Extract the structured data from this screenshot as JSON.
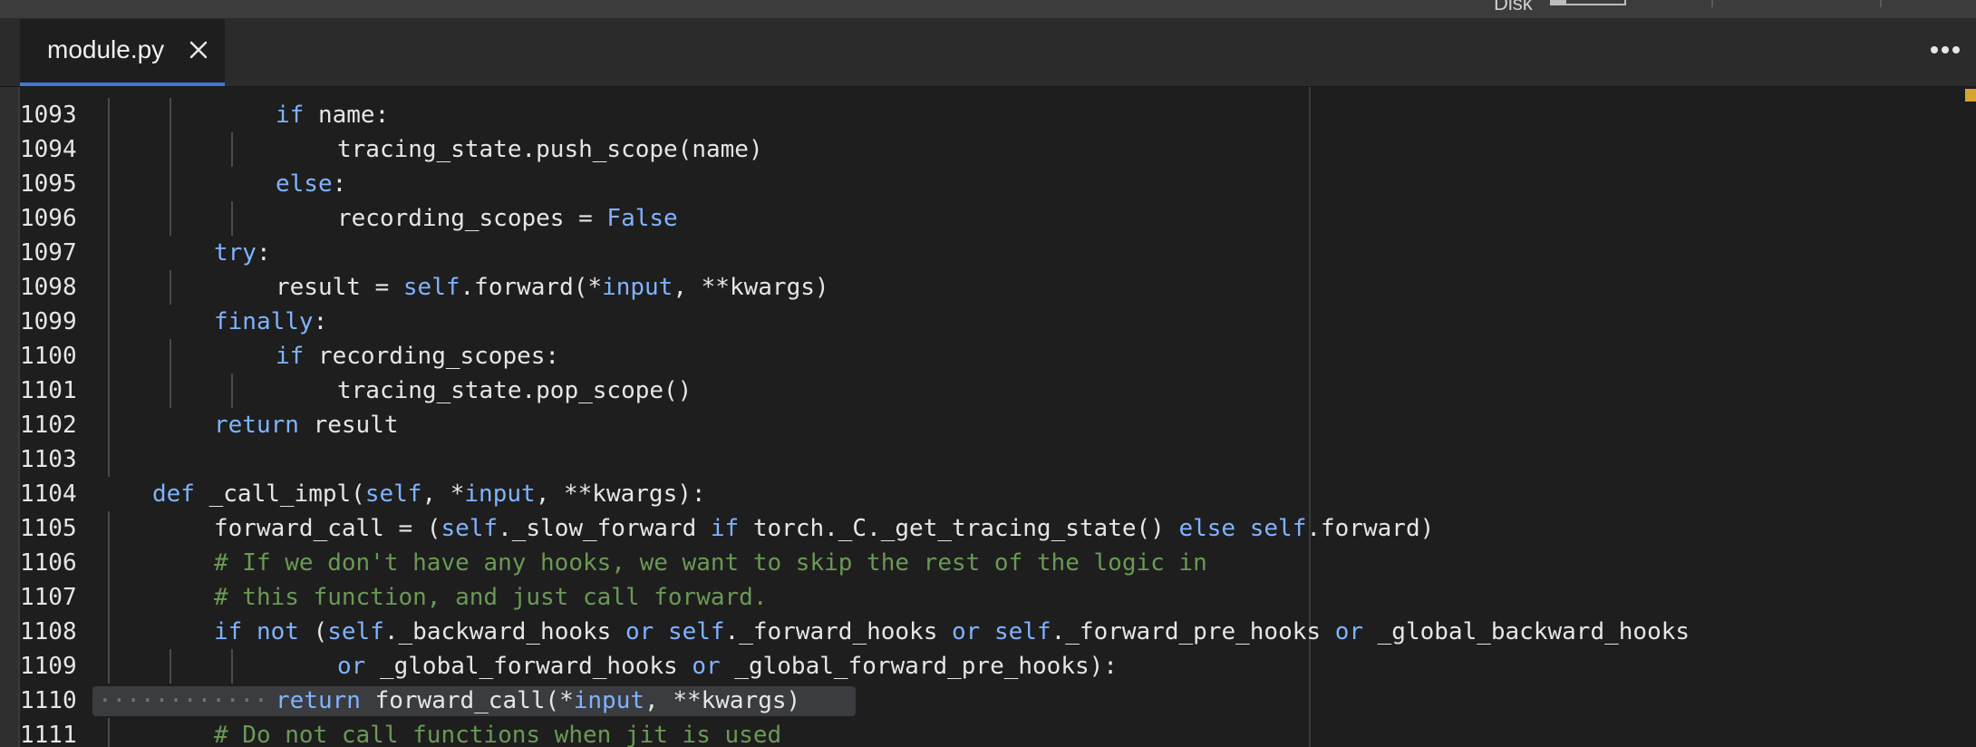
{
  "status_bar": {
    "disk_label": "Disk",
    "disk_usage_fraction": 0.2
  },
  "tab": {
    "label": "module.py",
    "close_icon": "close-icon"
  },
  "more_icon": "more-horizontal-icon",
  "colors": {
    "keyword": "#7fb3ff",
    "comment": "#6a9955",
    "text": "#e6e6e6",
    "accent": "#3d78d8",
    "overview_marker": "#d7a52d"
  },
  "lines": [
    {
      "number": "1093",
      "indent": 2,
      "segments": [
        {
          "t": "if",
          "k": "kw"
        },
        {
          "t": " name:"
        }
      ]
    },
    {
      "number": "1094",
      "indent": 3,
      "segments": [
        {
          "t": "tracing_state.push_scope(name)"
        }
      ]
    },
    {
      "number": "1095",
      "indent": 2,
      "segments": [
        {
          "t": "else",
          "k": "kw"
        },
        {
          "t": ":"
        }
      ]
    },
    {
      "number": "1096",
      "indent": 3,
      "segments": [
        {
          "t": "recording_scopes = "
        },
        {
          "t": "False",
          "k": "kw"
        }
      ]
    },
    {
      "number": "1097",
      "indent": 1,
      "segments": [
        {
          "t": "try",
          "k": "kw"
        },
        {
          "t": ":"
        }
      ]
    },
    {
      "number": "1098",
      "indent": 2,
      "segments": [
        {
          "t": "result = "
        },
        {
          "t": "self",
          "k": "kw"
        },
        {
          "t": ".forward(*"
        },
        {
          "t": "input",
          "k": "kw"
        },
        {
          "t": ", **kwargs)"
        }
      ]
    },
    {
      "number": "1099",
      "indent": 1,
      "segments": [
        {
          "t": "finally",
          "k": "kw"
        },
        {
          "t": ":"
        }
      ]
    },
    {
      "number": "1100",
      "indent": 2,
      "segments": [
        {
          "t": "if",
          "k": "kw"
        },
        {
          "t": " recording_scopes:"
        }
      ]
    },
    {
      "number": "1101",
      "indent": 3,
      "segments": [
        {
          "t": "tracing_state.pop_scope()"
        }
      ]
    },
    {
      "number": "1102",
      "indent": 1,
      "segments": [
        {
          "t": "return",
          "k": "kw"
        },
        {
          "t": " result"
        }
      ]
    },
    {
      "number": "1103",
      "indent": 0,
      "segments": []
    },
    {
      "number": "1104",
      "indent": 0,
      "segments": [
        {
          "t": "def",
          "k": "kw"
        },
        {
          "t": " _call_impl("
        },
        {
          "t": "self",
          "k": "kw"
        },
        {
          "t": ", *"
        },
        {
          "t": "input",
          "k": "kw"
        },
        {
          "t": ", **kwargs):"
        }
      ]
    },
    {
      "number": "1105",
      "indent": 1,
      "segments": [
        {
          "t": "forward_call = ("
        },
        {
          "t": "self",
          "k": "kw"
        },
        {
          "t": "._slow_forward "
        },
        {
          "t": "if",
          "k": "kw"
        },
        {
          "t": " torch._C._get_tracing_state() "
        },
        {
          "t": "else",
          "k": "kw"
        },
        {
          "t": " "
        },
        {
          "t": "self",
          "k": "kw"
        },
        {
          "t": ".forward)"
        }
      ]
    },
    {
      "number": "1106",
      "indent": 1,
      "segments": [
        {
          "t": "# If we don't have any hooks, we want to skip the rest of the logic in",
          "k": "cm"
        }
      ]
    },
    {
      "number": "1107",
      "indent": 1,
      "segments": [
        {
          "t": "# this function, and just call forward.",
          "k": "cm"
        }
      ]
    },
    {
      "number": "1108",
      "indent": 1,
      "segments": [
        {
          "t": "if not",
          "k": "kw"
        },
        {
          "t": " ("
        },
        {
          "t": "self",
          "k": "kw"
        },
        {
          "t": "._backward_hooks "
        },
        {
          "t": "or",
          "k": "kw"
        },
        {
          "t": " "
        },
        {
          "t": "self",
          "k": "kw"
        },
        {
          "t": "._forward_hooks "
        },
        {
          "t": "or",
          "k": "kw"
        },
        {
          "t": " "
        },
        {
          "t": "self",
          "k": "kw"
        },
        {
          "t": "._forward_pre_hooks "
        },
        {
          "t": "or",
          "k": "kw"
        },
        {
          "t": " _global_backward_hooks"
        }
      ]
    },
    {
      "number": "1109",
      "indent": 3,
      "segments": [
        {
          "t": "or",
          "k": "kw"
        },
        {
          "t": " _global_forward_hooks "
        },
        {
          "t": "or",
          "k": "kw"
        },
        {
          "t": " _global_forward_pre_hooks):"
        }
      ]
    },
    {
      "number": "1110",
      "indent": 2,
      "highlight": true,
      "segments": [
        {
          "t": "return",
          "k": "kw"
        },
        {
          "t": " forward_call(*"
        },
        {
          "t": "input",
          "k": "kw"
        },
        {
          "t": ", **kwargs)"
        }
      ]
    },
    {
      "number": "1111",
      "indent": 1,
      "segments": [
        {
          "t": "# Do not call functions when jit is used",
          "k": "cm"
        }
      ]
    }
  ]
}
